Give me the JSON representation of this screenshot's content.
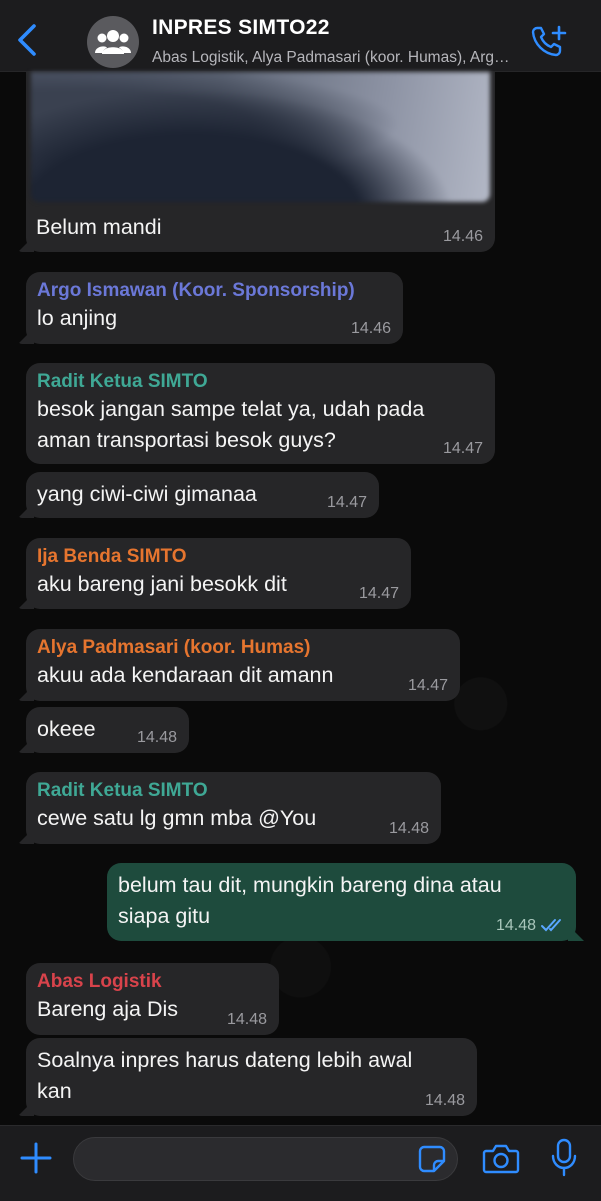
{
  "header": {
    "title": "INPRES SIMTO22",
    "subtitle": "Abas Logistik, Alya Padmasari (koor. Humas), Argo Ismawan, Ija Benda, Radit"
  },
  "colors": {
    "accent": "#2f8cff",
    "outgoing_bubble": "#1e4b3d",
    "incoming_bubble": "#262628",
    "argo": "#6b78d8",
    "radit": "#3fa895",
    "ija": "#e6752f",
    "alya": "#e6752f",
    "abas": "#d8434b"
  },
  "messages": [
    {
      "text": "Belum mandi",
      "time": "14.46"
    },
    {
      "sender": "Argo Ismawan (Koor. Sponsorship)",
      "text": "lo anjing",
      "time": "14.46"
    },
    {
      "sender": "Radit Ketua SIMTO",
      "text_line1": "besok jangan sampe telat ya, udah pada",
      "text_line2": "aman transportasi besok guys?",
      "time": "14.47"
    },
    {
      "text": "yang ciwi-ciwi gimanaa",
      "time": "14.47"
    },
    {
      "sender": "Ija Benda SIMTO",
      "text": "aku bareng jani besokk dit",
      "time": "14.47"
    },
    {
      "sender": "Alya Padmasari (koor. Humas)",
      "text": "akuu ada kendaraan dit amann",
      "time": "14.47"
    },
    {
      "text": "okeee",
      "time": "14.48"
    },
    {
      "sender": "Radit Ketua SIMTO",
      "text": "cewe satu lg gmn mba @You",
      "time": "14.48"
    },
    {
      "text_line1": "belum tau dit, mungkin bareng dina atau",
      "text_line2": "siapa gitu",
      "time": "14.48",
      "status": "read"
    },
    {
      "sender": "Abas Logistik",
      "text": "Bareng aja Dis",
      "time": "14.48"
    },
    {
      "text_line1": "Soalnya inpres harus dateng lebih awal",
      "text_line2": "kan",
      "time": "14.48"
    }
  ],
  "icons": {
    "back": "chevron-left-icon",
    "avatar": "group-icon",
    "call": "add-call-icon",
    "plus": "plus-icon",
    "sticker": "sticker-icon",
    "camera": "camera-icon",
    "mic": "microphone-icon"
  }
}
